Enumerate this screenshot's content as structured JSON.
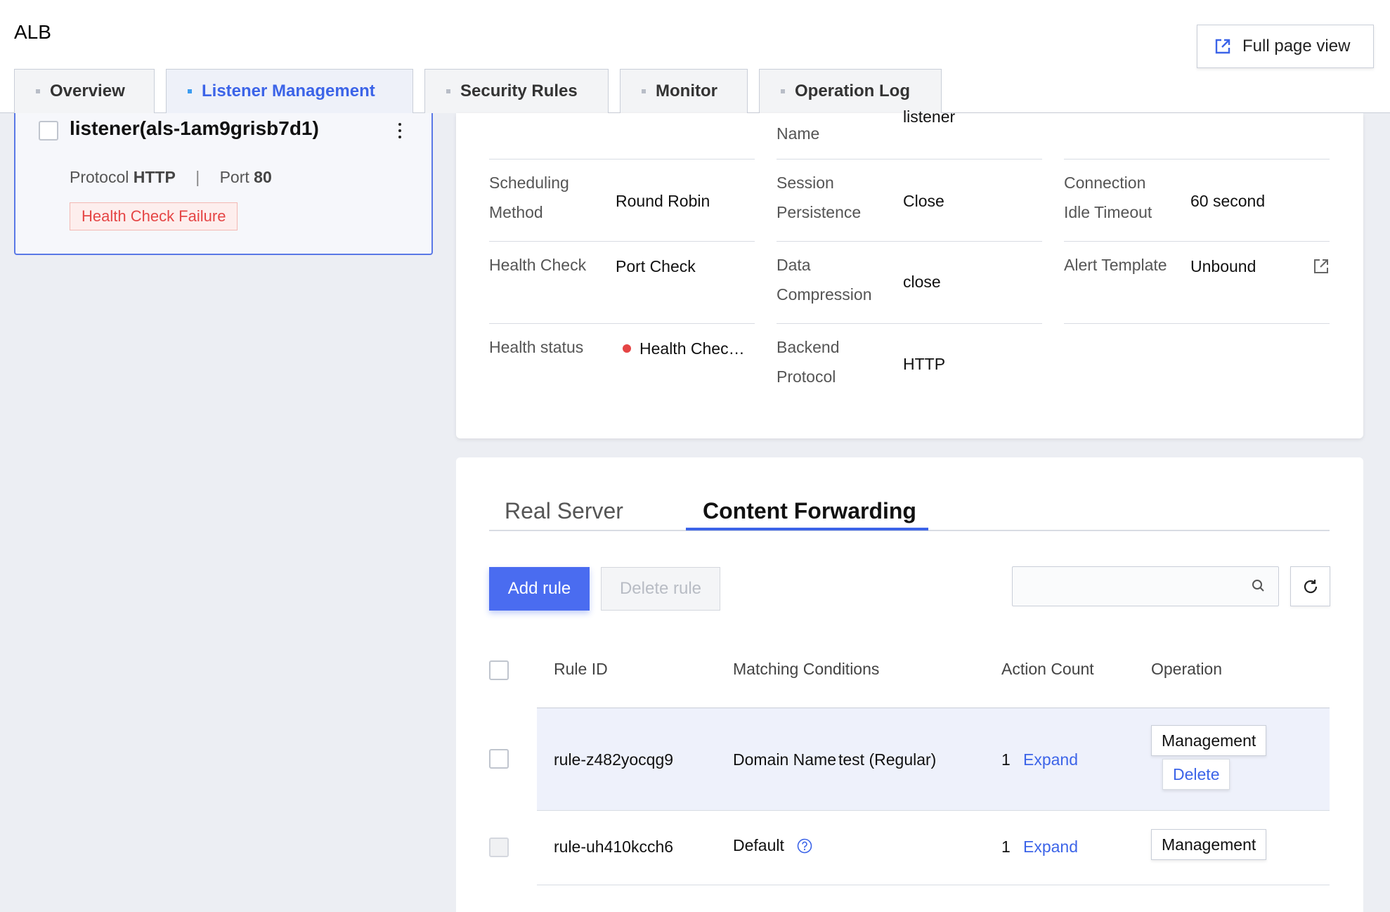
{
  "app": {
    "title": "ALB",
    "full_page_view": "Full page view"
  },
  "tabs": [
    {
      "label": "Overview"
    },
    {
      "label": "Listener Management"
    },
    {
      "label": "Security Rules"
    },
    {
      "label": "Monitor"
    },
    {
      "label": "Operation Log"
    }
  ],
  "listener": {
    "name": "listener(als-1am9grisb7d1)",
    "protocol_label": "Protocol",
    "protocol": "HTTP",
    "separator": "|",
    "port_label": "Port",
    "port": "80",
    "health_badge": "Health Check Failure"
  },
  "details": {
    "name_label": "Name",
    "name_value": "listener",
    "scheduling_label_1": "Scheduling",
    "scheduling_label_2": "Method",
    "scheduling_value": "Round Robin",
    "session_label_1": "Session",
    "session_label_2": "Persistence",
    "session_value": "Close",
    "idle_label_1": "Connection",
    "idle_label_2": "Idle Timeout",
    "idle_value": "60 second",
    "health_check_label": "Health Check",
    "health_check_value": "Port Check",
    "compression_label_1": "Data",
    "compression_label_2": "Compression",
    "compression_value": "close",
    "alert_label": "Alert Template",
    "alert_value": "Unbound",
    "health_status_label": "Health status",
    "health_status_value": "Health Chec…",
    "backend_label_1": "Backend",
    "backend_label_2": "Protocol",
    "backend_value": "HTTP"
  },
  "subtabs": [
    {
      "label": "Real Server"
    },
    {
      "label": "Content Forwarding"
    }
  ],
  "toolbar": {
    "add_rule": "Add rule",
    "delete_rule": "Delete rule",
    "search_placeholder": ""
  },
  "table": {
    "headers": {
      "rule_id": "Rule ID",
      "matching": "Matching Conditions",
      "action_count": "Action Count",
      "operation": "Operation"
    },
    "rows": [
      {
        "rule_id": "rule-z482yocqg9",
        "condition_type": "Domain Name",
        "condition_value": "test (Regular)",
        "count": "1",
        "expand": "Expand",
        "management": "Management",
        "delete": "Delete"
      },
      {
        "rule_id": "rule-uh410kcch6",
        "condition_type": "Default",
        "condition_value": "",
        "count": "1",
        "expand": "Expand",
        "management": "Management"
      }
    ]
  },
  "colors": {
    "accent": "#3c64e8",
    "error": "#e54545",
    "bg": "#eceef3"
  }
}
